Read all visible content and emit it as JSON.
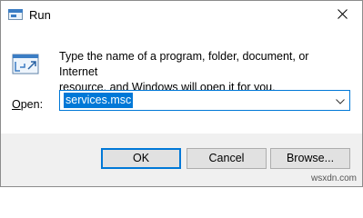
{
  "window": {
    "title": "Run",
    "accent_color": "#0078d7"
  },
  "icons": {
    "app": "run-icon",
    "close": "close-icon",
    "dropdown": "chevron-down-icon"
  },
  "dialog": {
    "description_line1": "Type the name of a program, folder, document, or Internet",
    "description_line2": "resource, and Windows will open it for you.",
    "open_label_mnemonic": "O",
    "open_label_rest": "pen:",
    "open_value": "services.msc"
  },
  "buttons": {
    "ok": "OK",
    "cancel": "Cancel",
    "browse": "Browse..."
  },
  "watermark": "wsxdn.com"
}
